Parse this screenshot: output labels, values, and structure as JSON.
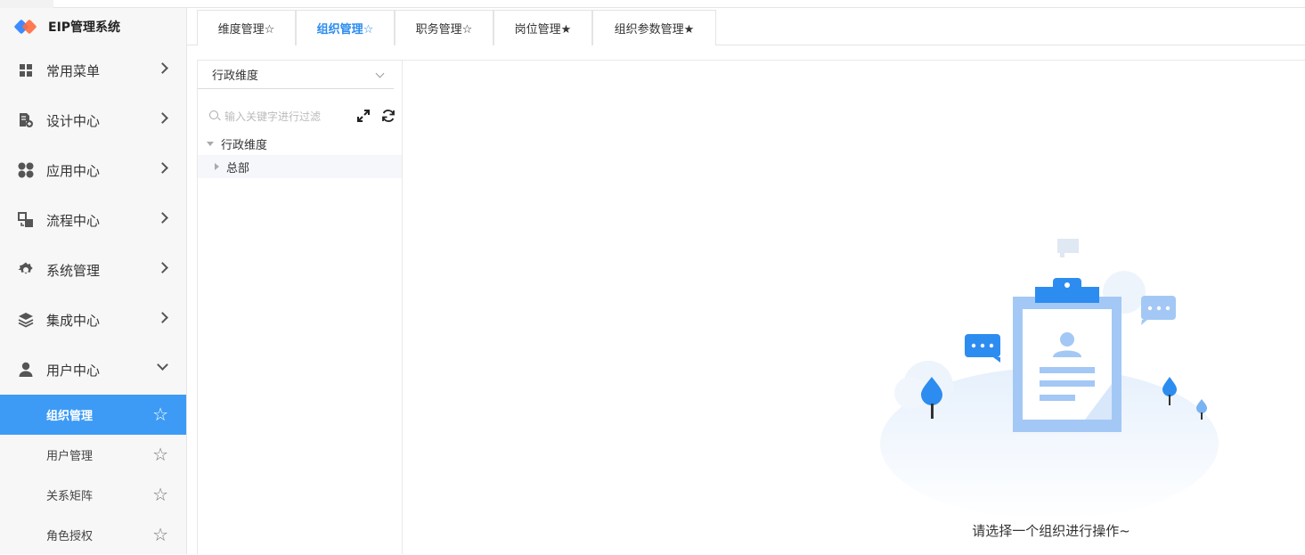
{
  "app": {
    "title": "EIP管理系统"
  },
  "sidebar": {
    "menus": [
      {
        "label": "常用菜单",
        "icon": "grid-icon"
      },
      {
        "label": "设计中心",
        "icon": "design-doc-icon"
      },
      {
        "label": "应用中心",
        "icon": "apps-icon"
      },
      {
        "label": "流程中心",
        "icon": "flow-icon"
      },
      {
        "label": "系统管理",
        "icon": "gear-icon"
      },
      {
        "label": "集成中心",
        "icon": "layers-icon"
      },
      {
        "label": "用户中心",
        "icon": "user-icon",
        "expanded": true
      }
    ],
    "submenu": [
      {
        "label": "组织管理",
        "active": true,
        "star": "☆"
      },
      {
        "label": "用户管理",
        "active": false,
        "star": "☆"
      },
      {
        "label": "关系矩阵",
        "active": false,
        "star": "☆"
      },
      {
        "label": "角色授权",
        "active": false,
        "star": "☆"
      }
    ]
  },
  "tabs": [
    {
      "label": "维度管理☆",
      "active": false
    },
    {
      "label": "组织管理☆",
      "active": true
    },
    {
      "label": "职务管理☆",
      "active": false
    },
    {
      "label": "岗位管理★",
      "active": false
    },
    {
      "label": "组织参数管理★",
      "active": false
    }
  ],
  "tree": {
    "dimension_value": "行政维度",
    "search_placeholder": "输入关键字进行过滤",
    "nodes": [
      {
        "label": "行政维度",
        "expanded": true
      },
      {
        "label": "总部",
        "expanded": false
      }
    ]
  },
  "content": {
    "empty_message": "请选择一个组织进行操作~"
  },
  "colors": {
    "accent": "#3d9bf5",
    "tab_active": "#2d8cf0"
  }
}
